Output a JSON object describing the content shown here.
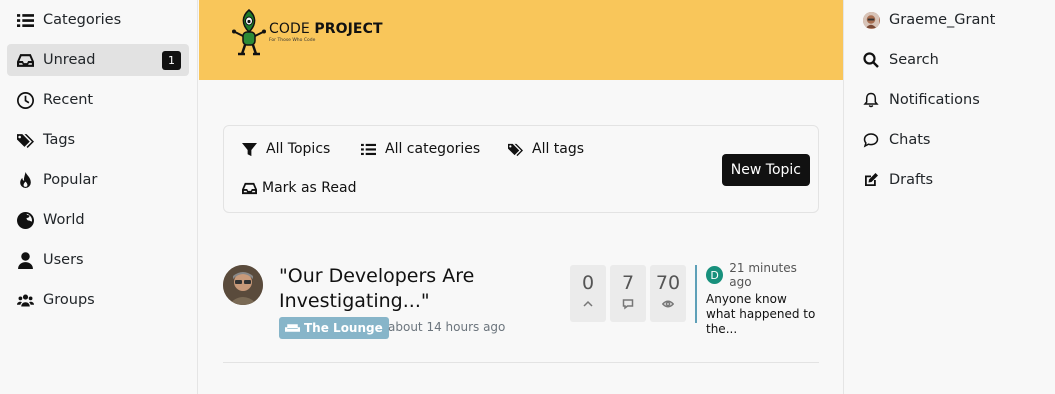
{
  "left_nav": [
    {
      "label": "Categories",
      "icon": "list-icon"
    },
    {
      "label": "Unread",
      "icon": "inbox-icon",
      "badge": "1",
      "active": true
    },
    {
      "label": "Recent",
      "icon": "clock-icon"
    },
    {
      "label": "Tags",
      "icon": "tags-icon"
    },
    {
      "label": "Popular",
      "icon": "fire-icon"
    },
    {
      "label": "World",
      "icon": "globe-icon"
    },
    {
      "label": "Users",
      "icon": "user-icon"
    },
    {
      "label": "Groups",
      "icon": "users-icon"
    }
  ],
  "banner": {
    "logo_prefix": "CODE ",
    "logo_bold": "PROJECT",
    "logo_tagline": "For Those Who Code",
    "color": "#f9c65a"
  },
  "toolbar": {
    "all_topics": "All Topics",
    "all_categories": "All categories",
    "all_tags": "All tags",
    "mark_as_read": "Mark as Read",
    "new_topic": "New Topic"
  },
  "topic": {
    "title": "\"Our Developers Are Investigating...\"",
    "category": "The Lounge",
    "category_color": "#87b5c9",
    "time": "about 14 hours ago",
    "votes": "0",
    "posts": "7",
    "views": "70",
    "teaser": {
      "avatar_letter": "D",
      "time": "21 minutes ago",
      "text": "Anyone know what happened to the..."
    }
  },
  "right_nav": {
    "username": "Graeme_Grant",
    "search": "Search",
    "notifications": "Notifications",
    "chats": "Chats",
    "drafts": "Drafts"
  }
}
